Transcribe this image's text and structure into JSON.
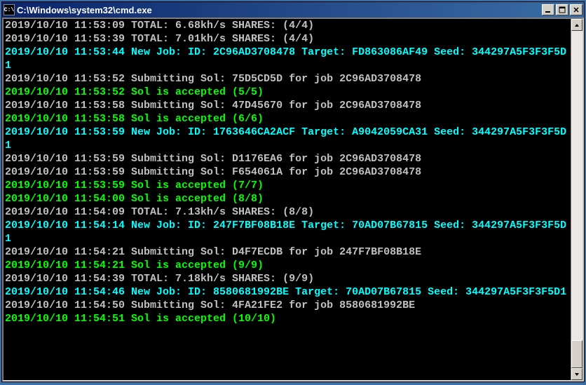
{
  "window": {
    "title": "C:\\Windows\\system32\\cmd.exe",
    "icon_label": "C:\\"
  },
  "lines": [
    {
      "class": "",
      "text": "2019/10/10 11:53:09 TOTAL: 6.68kh/s SHARES: (4/4)"
    },
    {
      "class": "",
      "text": "2019/10/10 11:53:39 TOTAL: 7.01kh/s SHARES: (4/4)"
    },
    {
      "class": "line-cyan",
      "text": "2019/10/10 11:53:44 New Job: ID: 2C96AD3708478 Target: FD863086AF49 Seed: 344297A5F3F3F5D1"
    },
    {
      "class": "",
      "text": "2019/10/10 11:53:52 Submitting Sol: 75D5CD5D for job 2C96AD3708478"
    },
    {
      "class": "line-green",
      "text": "2019/10/10 11:53:52 Sol is accepted (5/5)"
    },
    {
      "class": "",
      "text": "2019/10/10 11:53:58 Submitting Sol: 47D45670 for job 2C96AD3708478"
    },
    {
      "class": "line-green",
      "text": "2019/10/10 11:53:58 Sol is accepted (6/6)"
    },
    {
      "class": "line-cyan",
      "text": "2019/10/10 11:53:59 New Job: ID: 1763646CA2ACF Target: A9042059CA31 Seed: 344297A5F3F3F5D1"
    },
    {
      "class": "",
      "text": "2019/10/10 11:53:59 Submitting Sol: D1176EA6 for job 2C96AD3708478"
    },
    {
      "class": "",
      "text": "2019/10/10 11:53:59 Submitting Sol: F654061A for job 2C96AD3708478"
    },
    {
      "class": "line-green",
      "text": "2019/10/10 11:53:59 Sol is accepted (7/7)"
    },
    {
      "class": "line-green",
      "text": "2019/10/10 11:54:00 Sol is accepted (8/8)"
    },
    {
      "class": "",
      "text": "2019/10/10 11:54:09 TOTAL: 7.13kh/s SHARES: (8/8)"
    },
    {
      "class": "line-cyan",
      "text": "2019/10/10 11:54:14 New Job: ID: 247F7BF08B18E Target: 70AD07B67815 Seed: 344297A5F3F3F5D1"
    },
    {
      "class": "",
      "text": "2019/10/10 11:54:21 Submitting Sol: D4F7ECDB for job 247F7BF08B18E"
    },
    {
      "class": "line-green",
      "text": "2019/10/10 11:54:21 Sol is accepted (9/9)"
    },
    {
      "class": "",
      "text": "2019/10/10 11:54:39 TOTAL: 7.18kh/s SHARES: (9/9)"
    },
    {
      "class": "line-cyan",
      "text": "2019/10/10 11:54:46 New Job: ID: 8580681992BE Target: 70AD07B67815 Seed: 344297A5F3F3F5D1"
    },
    {
      "class": "",
      "text": "2019/10/10 11:54:50 Submitting Sol: 4FA21FE2 for job 8580681992BE"
    },
    {
      "class": "line-green",
      "text": "2019/10/10 11:54:51 Sol is accepted (10/10)"
    }
  ]
}
